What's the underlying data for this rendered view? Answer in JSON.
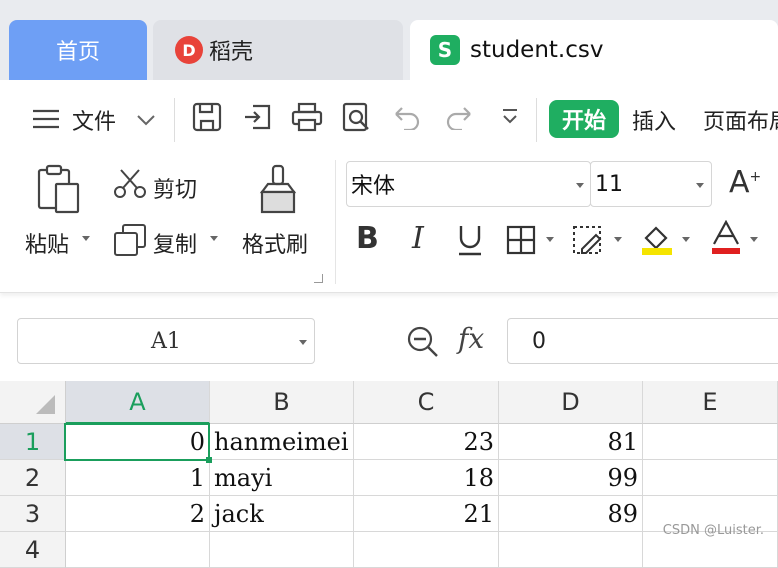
{
  "tabs": {
    "home_label": "首页",
    "daoke_label": "稻壳",
    "file_label": "student.csv"
  },
  "quickbar": {
    "menu_label": "文件",
    "start_label": "开始",
    "insert_label": "插入",
    "page_layout_label": "页面布局"
  },
  "ribbon": {
    "paste_label": "粘贴",
    "cut_label": "剪切",
    "copy_label": "复制",
    "format_painter_label": "格式刷",
    "font_name": "宋体",
    "font_size": "11",
    "font_color": "#e02020",
    "fill_color": "#f5e400"
  },
  "formula_bar": {
    "cell_ref": "A1",
    "fx_label": "fx",
    "value": "0"
  },
  "sheet": {
    "columns": [
      "A",
      "B",
      "C",
      "D",
      "E"
    ],
    "rows": [
      {
        "num": "1",
        "A": "0",
        "B": "hanmeimei",
        "C": "23",
        "D": "81",
        "E": ""
      },
      {
        "num": "2",
        "A": "1",
        "B": "mayi",
        "C": "18",
        "D": "99",
        "E": ""
      },
      {
        "num": "3",
        "A": "2",
        "B": "jack",
        "C": "21",
        "D": "89",
        "E": ""
      },
      {
        "num": "4",
        "A": "",
        "B": "",
        "C": "",
        "D": "",
        "E": ""
      }
    ]
  },
  "watermark": "CSDN @Luister.",
  "accent_color": "#1a9e5c"
}
